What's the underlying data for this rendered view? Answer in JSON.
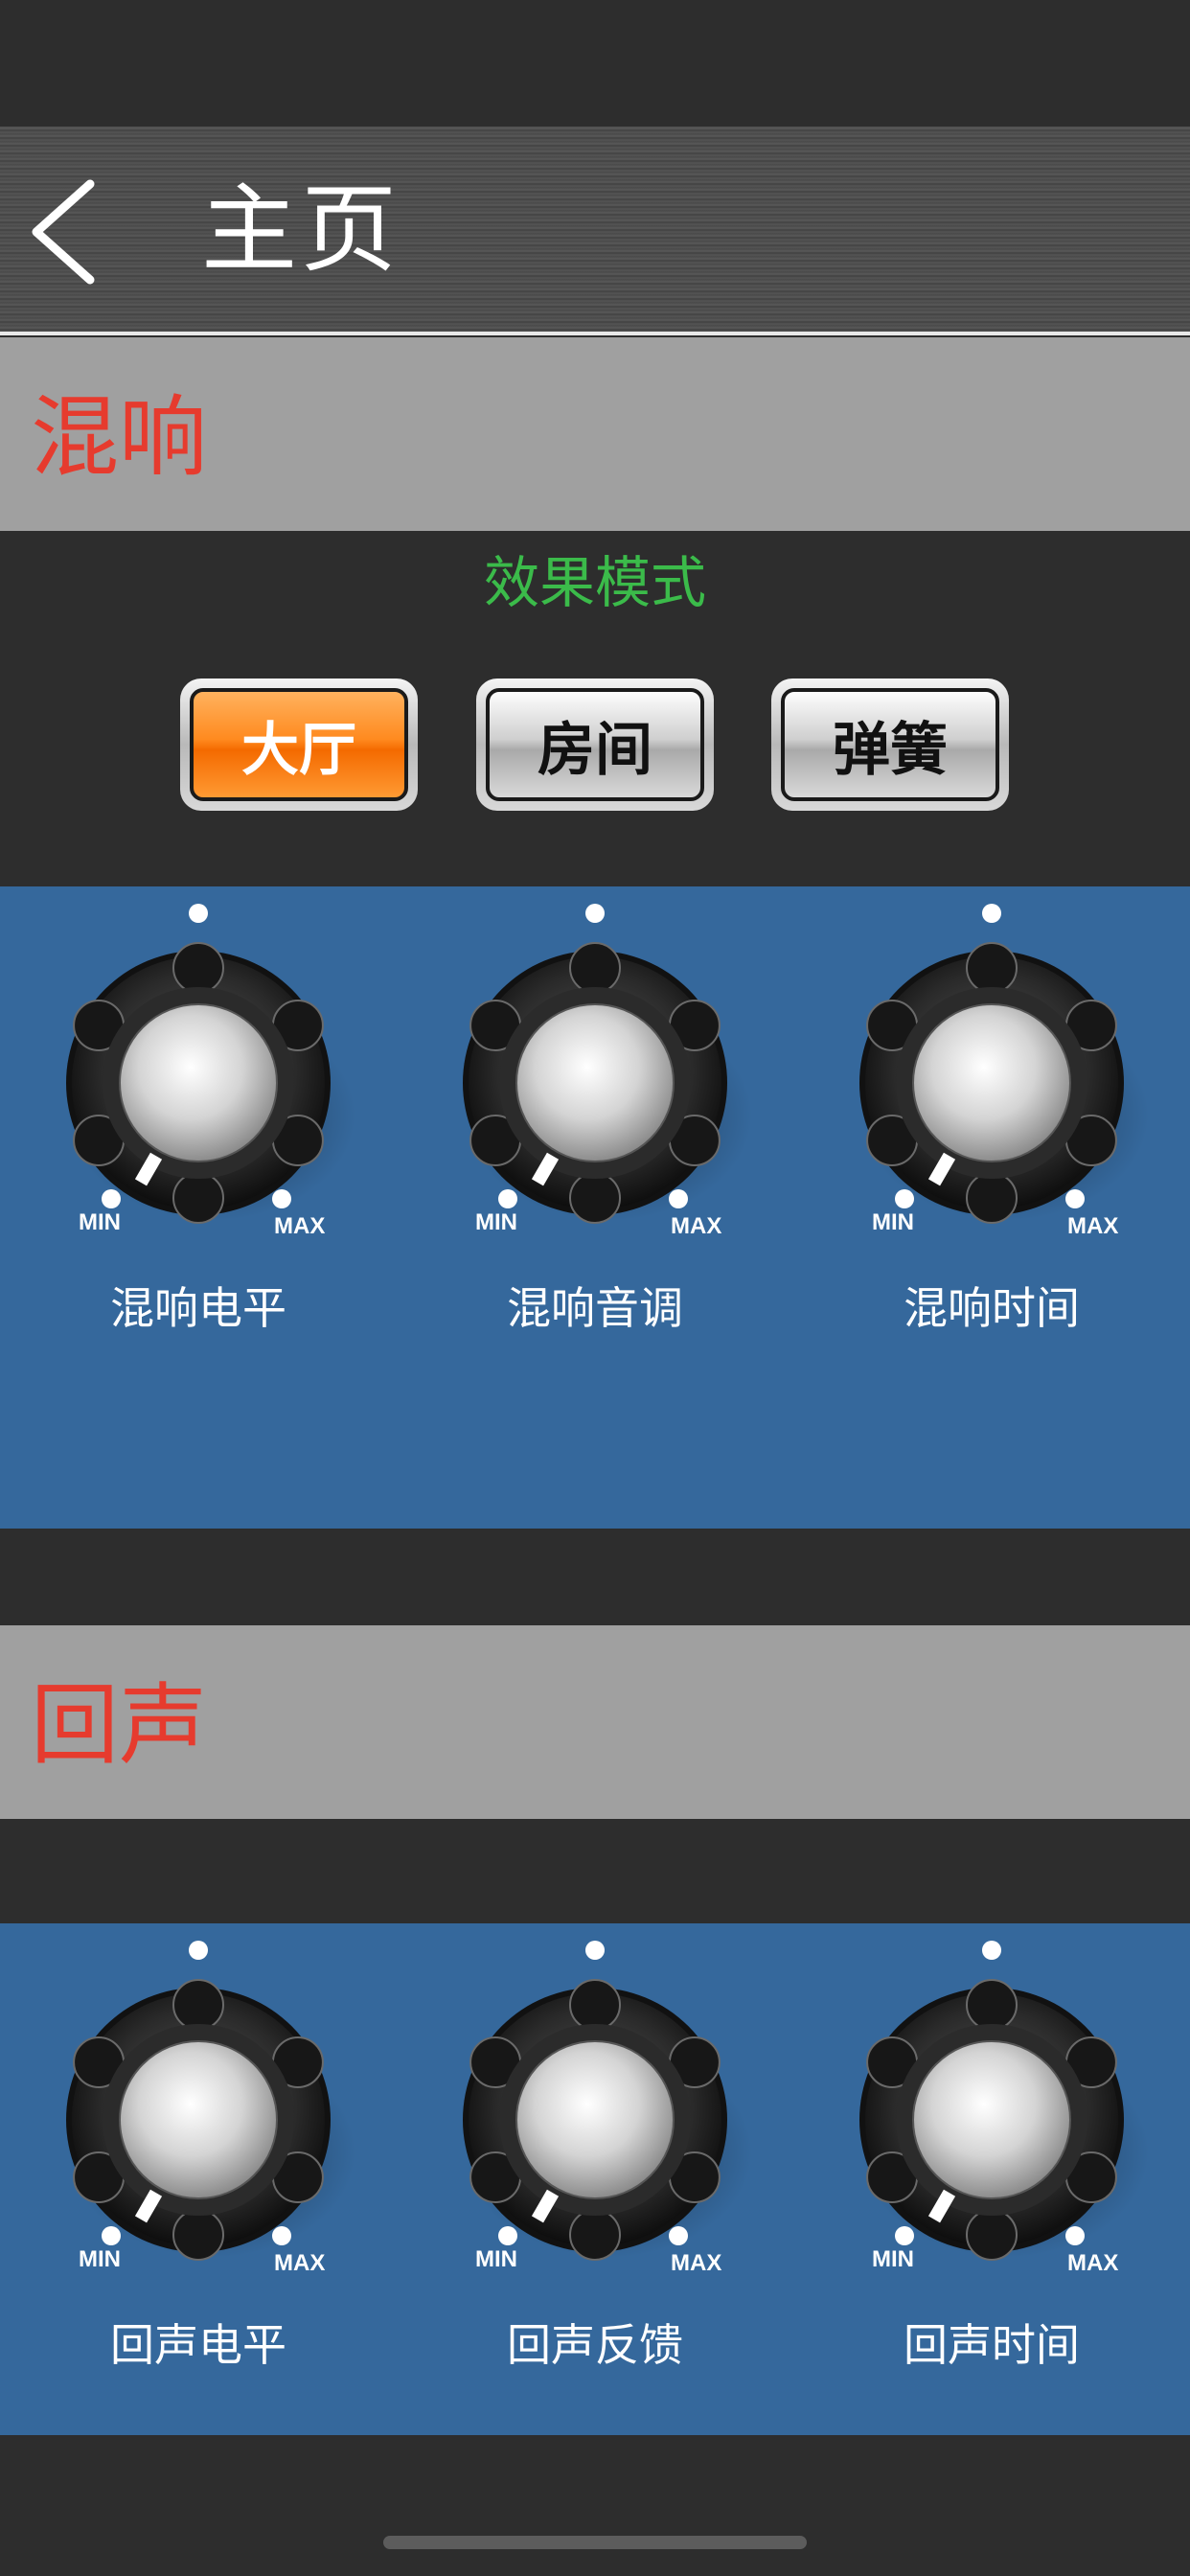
{
  "nav": {
    "title": "主页",
    "back_icon": "chevron-left-icon"
  },
  "reverb": {
    "title": "混响",
    "mode_label": "效果模式",
    "modes": [
      {
        "label": "大厅",
        "active": true
      },
      {
        "label": "房间",
        "active": false
      },
      {
        "label": "弹簧",
        "active": false
      }
    ],
    "knobs": [
      {
        "label": "混响电平",
        "min_label": "MIN",
        "max_label": "MAX",
        "level": 0.0
      },
      {
        "label": "混响音调",
        "min_label": "MIN",
        "max_label": "MAX",
        "level": 0.0
      },
      {
        "label": "混响时间",
        "min_label": "MIN",
        "max_label": "MAX",
        "level": 0.0
      }
    ]
  },
  "echo": {
    "title": "回声",
    "knobs": [
      {
        "label": "回声电平",
        "min_label": "MIN",
        "max_label": "MAX",
        "level": 0.0
      },
      {
        "label": "回声反馈",
        "min_label": "MIN",
        "max_label": "MAX",
        "level": 0.0
      },
      {
        "label": "回声时间",
        "min_label": "MIN",
        "max_label": "MAX",
        "level": 0.0
      }
    ]
  },
  "colors": {
    "section_title": "#e63b2e",
    "mode_label": "#3bbb4a",
    "active_mode": "#ff8a1f",
    "panel": "#35689c"
  }
}
